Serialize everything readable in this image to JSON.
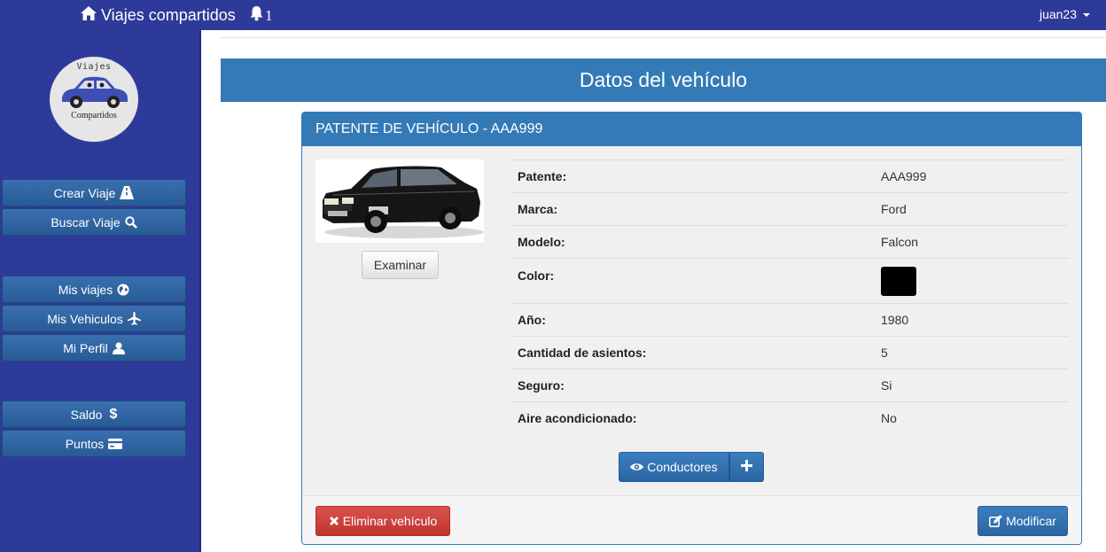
{
  "navbar": {
    "brand": "Viajes compartidos",
    "notifications_count": "1",
    "user": "juan23"
  },
  "sidebar": {
    "logo_top": "Viajes",
    "logo_bottom": "Compartidos",
    "items": [
      {
        "label": "Crear Viaje",
        "icon": "road-icon"
      },
      {
        "label": "Buscar Viaje",
        "icon": "search-icon"
      },
      {
        "label": "Mis viajes",
        "icon": "globe-icon"
      },
      {
        "label": "Mis Vehiculos",
        "icon": "plane-icon"
      },
      {
        "label": "Mi Perfil",
        "icon": "user-icon"
      },
      {
        "label": "Saldo",
        "icon": "dollar-icon"
      },
      {
        "label": "Puntos",
        "icon": "credit-card-icon"
      }
    ]
  },
  "page": {
    "title": "Datos del vehículo"
  },
  "panel": {
    "heading": "PATENTE DE VEHÍCULO - AAA999",
    "examinar_label": "Examinar",
    "rows": [
      {
        "key": "Patente:",
        "value": "AAA999"
      },
      {
        "key": "Marca:",
        "value": "Ford"
      },
      {
        "key": "Modelo:",
        "value": "Falcon"
      },
      {
        "key": "Color:",
        "value": ""
      },
      {
        "key": "Año:",
        "value": "1980"
      },
      {
        "key": "Cantidad de asientos:",
        "value": "5"
      },
      {
        "key": "Seguro:",
        "value": "Si"
      },
      {
        "key": "Aire acondicionado:",
        "value": "No"
      }
    ],
    "vehicle_color": "#000000",
    "conductores_label": "Conductores",
    "delete_label": "Eliminar vehículo",
    "modify_label": "Modificar"
  },
  "colors": {
    "navbar": "#2e3a9a",
    "primary": "#337ab7",
    "danger": "#d9534f"
  }
}
